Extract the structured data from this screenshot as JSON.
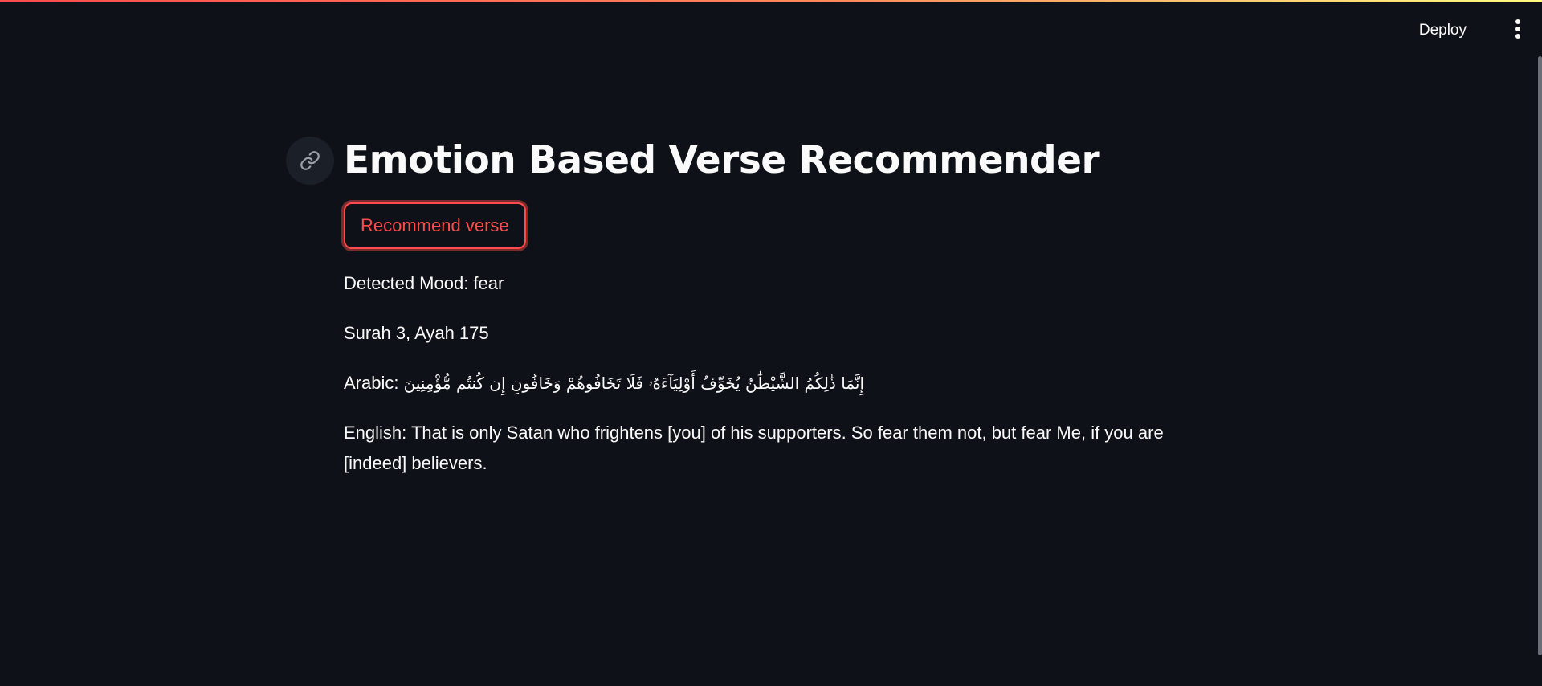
{
  "header": {
    "deploy_label": "Deploy",
    "menu_icon": "three-dots-vertical-icon"
  },
  "main": {
    "anchor_icon": "link-icon",
    "title": "Emotion Based Verse Recommender",
    "recommend_button_label": "Recommend verse",
    "detected_mood": "Detected Mood: fear",
    "surah_ayah": "Surah 3, Ayah 175",
    "arabic_label": "Arabic: ",
    "arabic_text": "إِنَّمَا ذَٰلِكُمُ الشَّيْطَٰنُ يُخَوِّفُ أَوْلِيَآءَهُۥ فَلَا تَخَافُوهُمْ وَخَافُونِ إِن كُنتُم مُّؤْمِنِينَ",
    "english": "English: That is only Satan who frightens [you] of his supporters. So fear them not, but fear Me, if you are [indeed] believers."
  },
  "colors": {
    "background": "#0e1117",
    "text": "#fafafa",
    "accent": "#ff4b4b"
  }
}
